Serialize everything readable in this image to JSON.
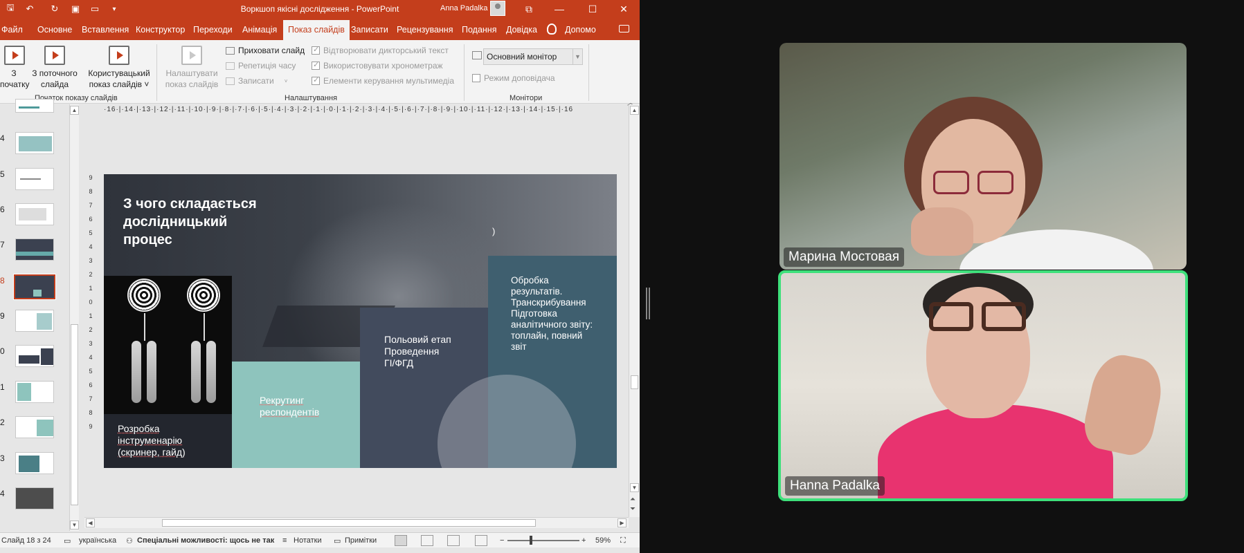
{
  "powerpoint": {
    "window_title": "Воркшоп якісні дослідження  -  PowerPoint",
    "user_name": "Anna Padalka",
    "tabs": [
      "Файл",
      "Основне",
      "Вставлення",
      "Конструктор",
      "Переходи",
      "Анімація",
      "Показ слайдів",
      "Записати",
      "Рецензування",
      "Подання",
      "Довідка",
      "Допомо"
    ],
    "active_tab": "Показ слайдів",
    "ribbon": {
      "from_beginning": "З\nпочатку",
      "from_current": "З поточного\nслайда",
      "custom_show": "Користувацький\nпоказ слайдів ˅",
      "setup_show": "Налаштувати\nпоказ слайдів",
      "hide_slide": "Приховати слайд",
      "rehearse": "Репетиція часу",
      "record": "Записати",
      "play_narrations": "Відтворювати дикторський текст",
      "use_timings": "Використовувати хронометраж",
      "media_controls": "Елементи керування мультимедіа",
      "monitor_select": "Основний монітор",
      "presenter_view": "Режим доповідача",
      "group_start": "Початок показу слайдів",
      "group_setup": "Налаштування",
      "group_monitors": "Монітори"
    },
    "thumbnails": [
      {
        "num": "",
        "kind": "text"
      },
      {
        "num": "4",
        "kind": "teal"
      },
      {
        "num": "5",
        "kind": "text"
      },
      {
        "num": "6",
        "kind": "text"
      },
      {
        "num": "7",
        "kind": "dark"
      },
      {
        "num": "8",
        "kind": "dark",
        "selected": true
      },
      {
        "num": "9",
        "kind": "teal"
      },
      {
        "num": "0",
        "kind": "dark"
      },
      {
        "num": "1",
        "kind": "teal"
      },
      {
        "num": "2",
        "kind": "text"
      },
      {
        "num": "3",
        "kind": "teal"
      },
      {
        "num": "4",
        "kind": "dark"
      }
    ],
    "ruler_h": "·16·|·14·|·13·|·12·|·11·|·10·|·9·|·8·|·7·|·6·|·5·|·4·|·3·|·2·|·1·|·0·|·1·|·2·|·3·|·4·|·5·|·6·|·7·|·8·|·9·|·10·|·11·|·12·|·13·|·14·|·15·|·16",
    "ruler_v": [
      "9",
      "8",
      "7",
      "6",
      "5",
      "4",
      "3",
      "2",
      "1",
      "0",
      "1",
      "2",
      "3",
      "4",
      "5",
      "6",
      "7",
      "8",
      "9"
    ],
    "slide": {
      "title": "З чого складається\nдослідницький\nпроцес",
      "mark": ")",
      "block1": "Розробка\nінструменарію\n(скринер, гайд)",
      "block2": "Рекрутинг\nреспондентів",
      "block3": "Польовий етап\nПроведення\nГІ/ФГД",
      "block4": "Обробка\nрезультатів.\nТранскрибування\nПідготовка\nаналітичного звіту:\nтоплайн, повний\nзвіт"
    },
    "status": {
      "slide_counter": "Слайд 18 з 24",
      "language": "українська",
      "accessibility": "Спеціальні можливості: щось не так",
      "notes": "Нотатки",
      "comments": "Примітки",
      "zoom": "59%"
    }
  },
  "call": {
    "participants": [
      {
        "name": "Марина Мостовая",
        "speaking": false
      },
      {
        "name": "Hanna Padalka",
        "speaking": true
      }
    ],
    "active_border_color": "#3ee07b"
  },
  "colors": {
    "ppt_accent": "#c43e1c",
    "teal_block": "#8ec4bd",
    "navy_block": "#424b5d",
    "slate_block": "#3f5f6f"
  }
}
